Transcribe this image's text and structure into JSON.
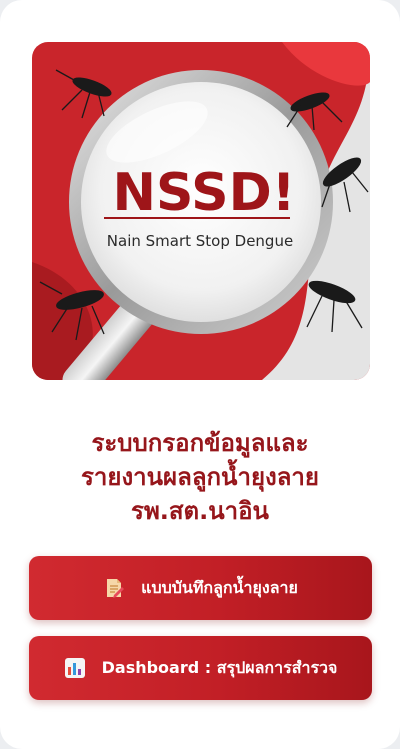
{
  "hero": {
    "logo_text": "NSSD!",
    "logo_subtitle": "Nain Smart Stop Dengue"
  },
  "title": {
    "line1": "ระบบกรอกข้อมูลและ",
    "line2": "รายงานผลลูกน้ำยุงลาย",
    "line3": "รพ.สต.นาอิน"
  },
  "buttons": {
    "record_form": {
      "label": "แบบบันทึกลูกน้ำยุงลาย",
      "icon": "memo-icon"
    },
    "dashboard": {
      "label": "Dashboard : สรุปผลการสำรวจ",
      "icon": "bar-chart-icon"
    }
  },
  "colors": {
    "brand_red": "#c21f26",
    "title_red": "#96161b",
    "background": "#ffffff"
  }
}
